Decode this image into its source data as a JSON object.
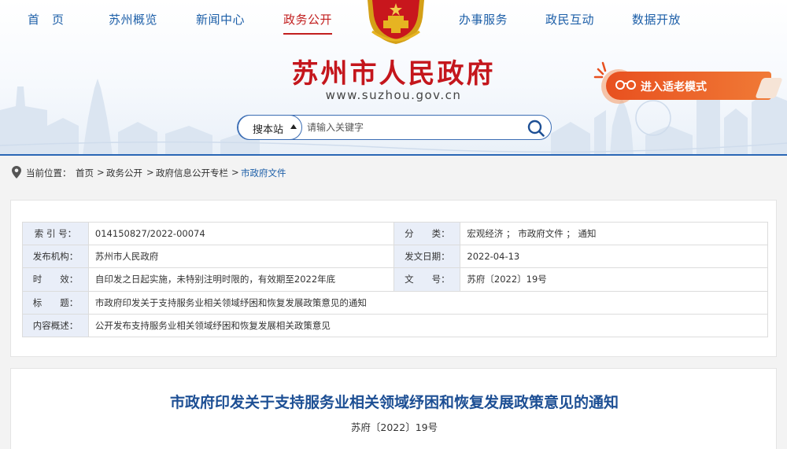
{
  "nav": {
    "items": [
      {
        "label": "首　页"
      },
      {
        "label": "苏州概览"
      },
      {
        "label": "新闻中心"
      },
      {
        "label": "政务公开"
      },
      {
        "label": "办事服务"
      },
      {
        "label": "政民互动"
      },
      {
        "label": "数据开放"
      }
    ],
    "active_index": 3
  },
  "site": {
    "title": "苏州市人民政府",
    "url": "www.suzhou.gov.cn"
  },
  "elder_mode": {
    "label": "进入适老模式"
  },
  "search": {
    "scope": "搜本站",
    "placeholder": "请输入关键字"
  },
  "breadcrumb": {
    "label": "当前位置：",
    "items": [
      "首页",
      "政务公开",
      "政府信息公开专栏",
      "市政府文件"
    ],
    "separator": ">"
  },
  "info": {
    "rows": [
      {
        "k1": "索 引 号：",
        "v1": "014150827/2022-00074",
        "k2": "分　　类：",
        "v2": "宏观经济 ； 市政府文件 ； 通知"
      },
      {
        "k1": "发布机构：",
        "v1": "苏州市人民政府",
        "k2": "发文日期：",
        "v2": "2022-04-13"
      },
      {
        "k1": "时　　效：",
        "v1": "自印发之日起实施，未特别注明时限的，有效期至2022年底",
        "k2": "文　　号：",
        "v2": "苏府〔2022〕19号"
      }
    ],
    "title_key": "标　　题：",
    "title_value": "市政府印发关于支持服务业相关领域纾困和恢复发展政策意见的通知",
    "summary_key": "内容概述：",
    "summary_value": "公开发布支持服务业相关领域纾困和恢复发展相关政策意见"
  },
  "document": {
    "title": "市政府印发关于支持服务业相关领域纾困和恢复发展政策意见的通知",
    "number": "苏府〔2022〕19号"
  },
  "colors": {
    "brand_red": "#c4161c",
    "nav_blue": "#1d5fa8",
    "doc_title_blue": "#1d4f94",
    "elder_orange": "#e8501f",
    "key_cell_bg": "#e9eef8"
  }
}
